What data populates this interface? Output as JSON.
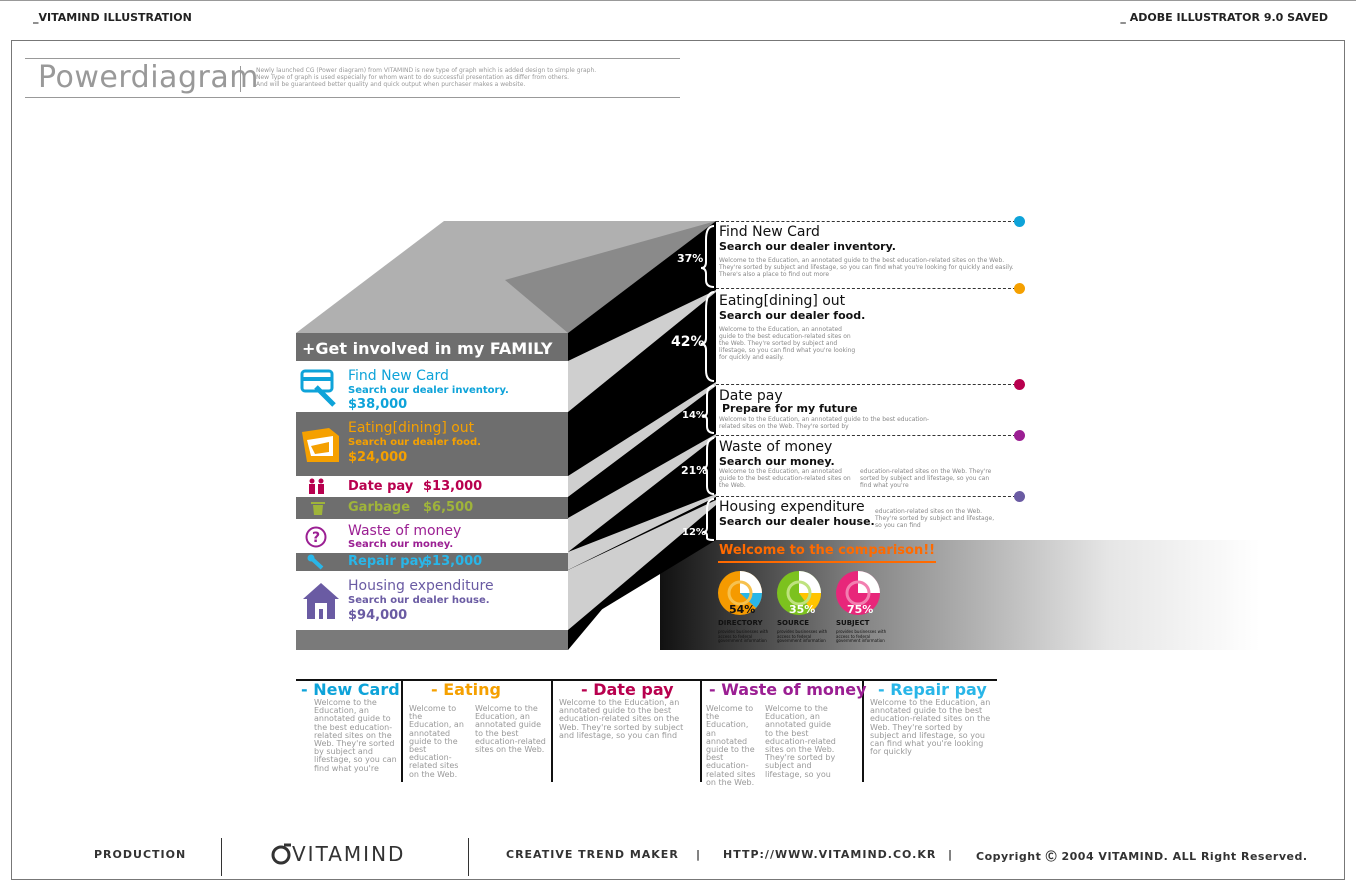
{
  "header": {
    "left": "_VITAMIND ILLUSTRATION",
    "right": "_ ADOBE ILLUSTRATOR 9.0 SAVED"
  },
  "title": {
    "text": "Powerdiagram",
    "desc1": "Newly launched CG (Power diagram) from VITAMIND is new type of graph which is added design to simple graph.",
    "desc2": "New Type of graph is used especially for whom want to do successful presentation as differ from others.",
    "desc3": "And will be guaranteed better quality and quick output when purchaser makes a website."
  },
  "table": {
    "head": "+Get involved in my FAMILY",
    "card_title": "Find New Card",
    "card_sub": "Search our dealer inventory.",
    "card_amount": "$38,000",
    "eat_title": "Eating[dining] out",
    "eat_sub": "Search our dealer food.",
    "eat_amount": "$24,000",
    "date": "Date pay",
    "date_amount": "$13,000",
    "garbage": "Garbage",
    "garbage_amount": "$6,500",
    "waste_title": "Waste of money",
    "waste_sub": "Search our money.",
    "repair": "Repair pay",
    "repair_amount": "$13,000",
    "house_title": "Housing expenditure",
    "house_sub": "Search our dealer house.",
    "house_amount": "$94,000"
  },
  "percents": {
    "p1": "37%",
    "p2": "42%",
    "p3": "14%",
    "p4": "21%",
    "p5": "12%"
  },
  "right": {
    "r1_title": "Find New Card",
    "r1_sub": "Search our dealer inventory.",
    "r1_text": "Welcome to the Education, an annotated guide to the best education-related sites on the Web. They're sorted by subject and lifestage, so you can find what you're looking for quickly and easily. There's also a place to find out more",
    "r2_title": "Eating[dining] out",
    "r2_sub": "Search our dealer food.",
    "r2_text": "Welcome to the Education, an annotated guide to the best education-related sites on the Web. They're sorted by subject and lifestage, so you can find what you're looking for quickly and easily.",
    "r3_title": "Date pay",
    "r3_sub": "Prepare for my future",
    "r3_text": "Welcome to the Education, an annotated guide to the best education-related sites on the Web. They're sorted by",
    "r4_title": "Waste of money",
    "r4_sub": "Search our money.",
    "r4_text_a": "Welcome to the Education, an annotated guide to the best education-related sites on the Web.",
    "r4_text_b": "education-related sites on the Web. They're sorted by subject and lifestage, so you can find what you're",
    "r5_title": "Housing expenditure",
    "r5_sub": "Search our dealer house.",
    "r5_text": "education-related sites on the Web. They're sorted by subject and lifestage, so you can find"
  },
  "comparison": {
    "title": "Welcome to the comparison!!",
    "pies": [
      {
        "value": "54%",
        "label": "DIRECTORY",
        "note": "provides businesses with access to federal government information"
      },
      {
        "value": "35%",
        "label": "SOURCE",
        "note": "provides businesses with access to federal government information"
      },
      {
        "value": "75%",
        "label": "SUBJECT",
        "note": "provides businesses with access to federal government information"
      }
    ]
  },
  "bottom": {
    "c1_head": "- New Card",
    "c1_text": "Welcome to the Education, an annotated guide to the best education-related sites on the Web. They're sorted by subject and lifestage, so you can find what you're",
    "c2_head": "- Eating",
    "c2_text_a": "Welcome to the Education, an annotated guide to the best education-related sites on the Web.",
    "c2_text_b": "Welcome to the Education, an annotated guide to the best education-related sites on the Web.",
    "c3_head": "- Date pay",
    "c3_text": "Welcome to the Education, an annotated guide to the best education-related sites on the Web. They're sorted by subject and lifestage, so you can find",
    "c4_head": "- Waste of money",
    "c4_text_a": "Welcome to the Education, an annotated guide to the best education-related sites on the Web.",
    "c4_text_b": "Welcome to the Education, an annotated guide to the best education-related sites on the Web. They're sorted by subject and lifestage, so you",
    "c5_head": "- Repair pay",
    "c5_text": "Welcome to the Education, an annotated guide to the best education-related sites on the Web. They're sorted by subject and lifestage, so you can find what you're looking for quickly"
  },
  "footer": {
    "production": "PRODUCTION",
    "logo": "VITAMIND",
    "creative": "CREATIVE TREND MAKER",
    "sep": "|",
    "url": "HTTP://WWW.VITAMIND.CO.KR",
    "copyright": "Copyright Ⓒ 2004 VITAMIND. ALL Right Reserved."
  },
  "colors": {
    "card": "#0ea3d9",
    "eat": "#f5a000",
    "date": "#b8004e",
    "garbage": "#9fb43a",
    "waste": "#9b1f93",
    "repair": "#29b6e8",
    "house": "#6a5ba3",
    "orange": "#ff6a00"
  }
}
